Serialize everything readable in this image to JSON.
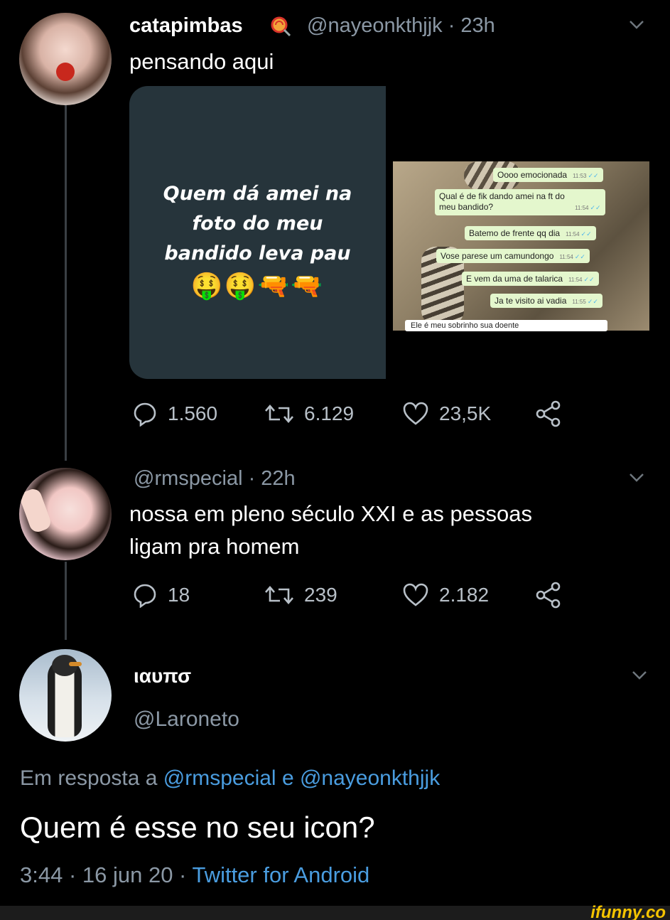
{
  "tweet1": {
    "name": "catapimbas",
    "handle_time": "@nayeonkthjjk · 23h",
    "text": "pensando aqui",
    "meme_lines": [
      "Quem dá amei na",
      "foto do meu",
      "bandido leva pau"
    ],
    "meme_emojis": "🤑🤑🔫🔫",
    "chat": {
      "messages": [
        {
          "text": "Oooo emocionada",
          "time": "11:53"
        },
        {
          "text": "Qual é de fik dando amei na ft do",
          "text2": "meu bandido?",
          "time": "11:54"
        },
        {
          "text": "Batemo de frente qq dia",
          "time": "11:54"
        },
        {
          "text": "Vose parese um camundongo",
          "time": "11:54"
        },
        {
          "text": "E vem da uma de talarica",
          "time": "11:54"
        },
        {
          "text": "Ja te visito ai vadia",
          "time": "11:55"
        }
      ],
      "cut_text": "Ele é meu sobrinho sua doente"
    },
    "replies": "1.560",
    "retweets": "6.129",
    "likes": "23,5K"
  },
  "tweet2": {
    "handle_time": "@rmspecial · 22h",
    "text_line1": "nossa em pleno século XXI e as pessoas",
    "text_line2": "ligam pra homem",
    "replies": "18",
    "retweets": "239",
    "likes": "2.182"
  },
  "tweet3": {
    "name": "ιαυπσ",
    "handle": "@Laroneto",
    "reply_prefix": "Em resposta a",
    "reply_user1": "@rmspecial",
    "reply_and": "e",
    "reply_user2": "@nayeonkthjjk",
    "text": "Quem é esse no seu icon?",
    "timestamp": "3:44 · 16 jun 20 ·",
    "source": "Twitter for Android"
  },
  "watermark": "ifunny.co",
  "colors": {
    "background": "#000000",
    "muted": "#8b98a5",
    "link": "#4a9de0",
    "card": "#26343b"
  }
}
